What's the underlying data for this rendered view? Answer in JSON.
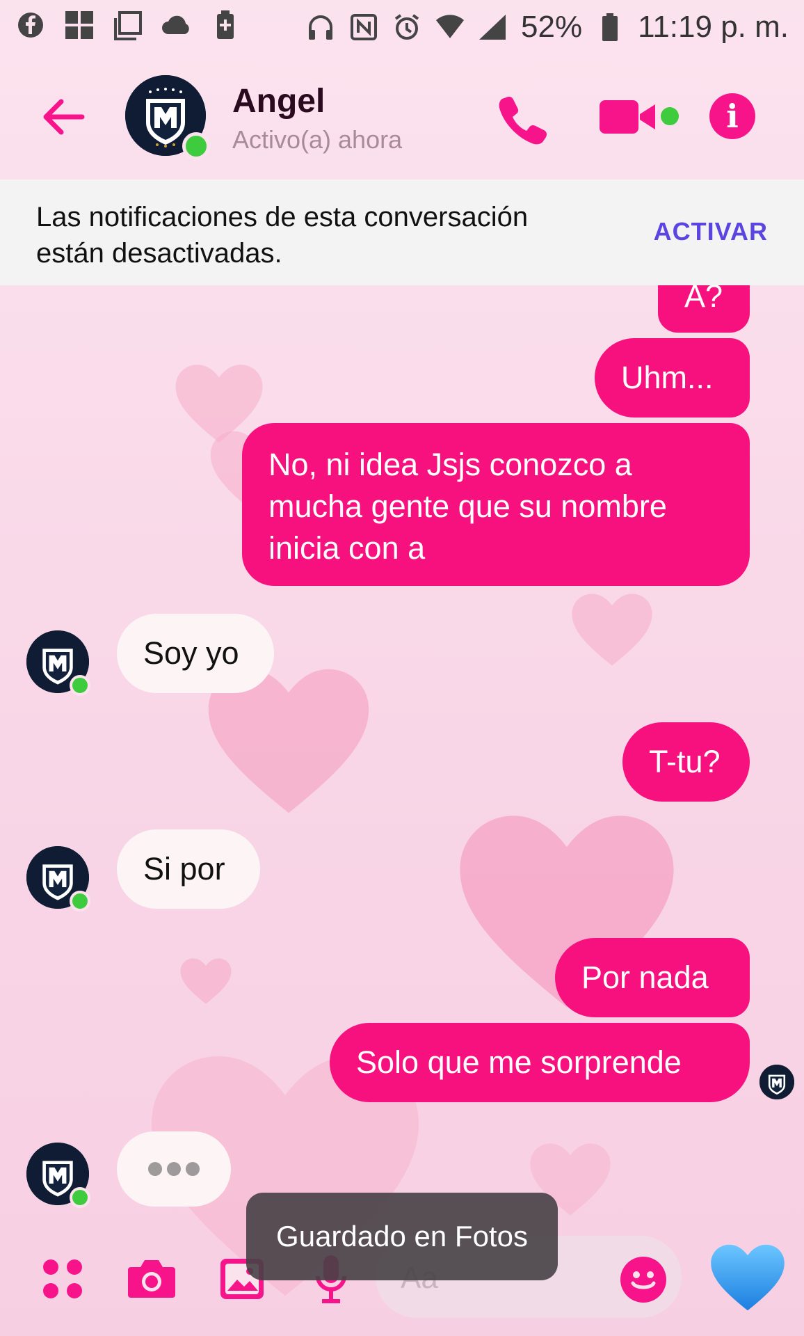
{
  "status_bar": {
    "battery": "52%",
    "time": "11:19 p. m."
  },
  "header": {
    "contact_name": "Angel",
    "contact_status": "Activo(a) ahora"
  },
  "banner": {
    "text": "Las notificaciones de esta conversación están desactivadas.",
    "action": "ACTIVAR"
  },
  "messages": [
    {
      "side": "out",
      "text": "A?"
    },
    {
      "side": "out",
      "text": "Uhm..."
    },
    {
      "side": "out",
      "text": "No, ni idea Jsjs conozco a mucha gente que su nombre inicia con a"
    },
    {
      "side": "in",
      "text": "Soy yo"
    },
    {
      "side": "out",
      "text": "T-tu?"
    },
    {
      "side": "in",
      "text": "Si por"
    },
    {
      "side": "out",
      "text": "Por nada"
    },
    {
      "side": "out",
      "text": "Solo que me sorprende"
    }
  ],
  "toast": "Guardado en Fotos",
  "composer": {
    "placeholder": "Aa"
  },
  "colors": {
    "accent": "#f7117f",
    "banner_action": "#5b45e0",
    "online": "#3ecb3e"
  }
}
